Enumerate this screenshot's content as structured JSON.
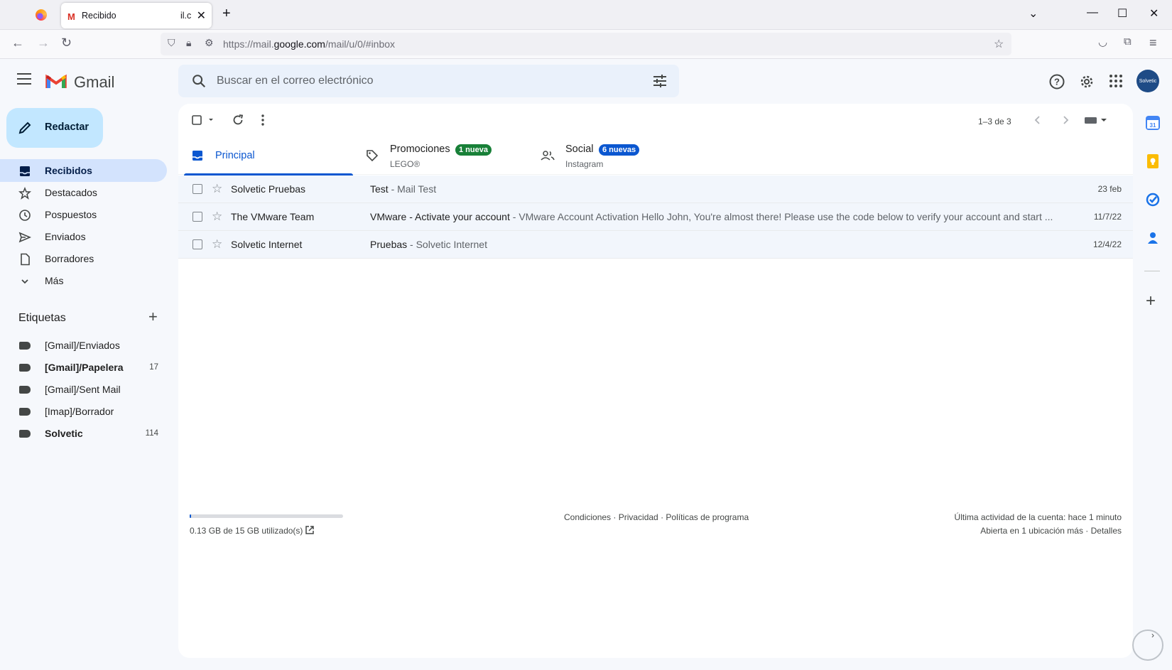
{
  "browser": {
    "tab_title": "Recibido",
    "tab_title_tail": "il.c",
    "url_prefix": "https://mail.",
    "url_domain": "google.com",
    "url_suffix": "/mail/u/0/#inbox"
  },
  "header": {
    "brand": "Gmail",
    "search_placeholder": "Buscar en el correo electrónico",
    "avatar_text": "Solvetic"
  },
  "sidebar": {
    "compose_label": "Redactar",
    "items": [
      {
        "label": "Recibidos",
        "icon": "inbox-icon",
        "active": true
      },
      {
        "label": "Destacados",
        "icon": "star-icon"
      },
      {
        "label": "Pospuestos",
        "icon": "clock-icon"
      },
      {
        "label": "Enviados",
        "icon": "send-icon"
      },
      {
        "label": "Borradores",
        "icon": "draft-icon"
      },
      {
        "label": "Más",
        "icon": "chevron-down-icon"
      }
    ],
    "labels_title": "Etiquetas",
    "labels": [
      {
        "label": "[Gmail]/Enviados",
        "count": ""
      },
      {
        "label": "[Gmail]/Papelera",
        "count": "17"
      },
      {
        "label": "[Gmail]/Sent Mail",
        "count": ""
      },
      {
        "label": "[Imap]/Borrador",
        "count": ""
      },
      {
        "label": "Solvetic",
        "count": "114"
      }
    ]
  },
  "toolbar": {
    "pager": "1–3 de 3"
  },
  "category_tabs": [
    {
      "name": "Principal",
      "sub": "",
      "badge": "",
      "active": true
    },
    {
      "name": "Promociones",
      "sub": "LEGO®",
      "badge": "1 nueva",
      "badge_color": "#188038"
    },
    {
      "name": "Social",
      "sub": "Instagram",
      "badge": "6 nuevas",
      "badge_color": "#0b57d0"
    }
  ],
  "emails": [
    {
      "sender": "Solvetic Pruebas",
      "subject": "Test",
      "snippet": " - Mail Test",
      "date": "23 feb"
    },
    {
      "sender": "The VMware Team",
      "subject": "VMware - Activate your account",
      "snippet": " - VMware Account Activation Hello John, You're almost there! Please use the code below to verify your account and start ...",
      "date": "11/7/22"
    },
    {
      "sender": "Solvetic Internet",
      "subject": "Pruebas",
      "snippet": " - Solvetic Internet",
      "date": "12/4/22"
    }
  ],
  "footer": {
    "storage": "0.13 GB de 15 GB utilizado(s)",
    "links": "Condiciones · Privacidad · Políticas de programa",
    "activity": "Última actividad de la cuenta: hace 1 minuto",
    "details": "Abierta en 1 ubicación más · Detalles"
  },
  "colors": {
    "accent": "#0b57d0",
    "compose_bg": "#c2e7ff",
    "active_nav_bg": "#d3e3fd"
  }
}
